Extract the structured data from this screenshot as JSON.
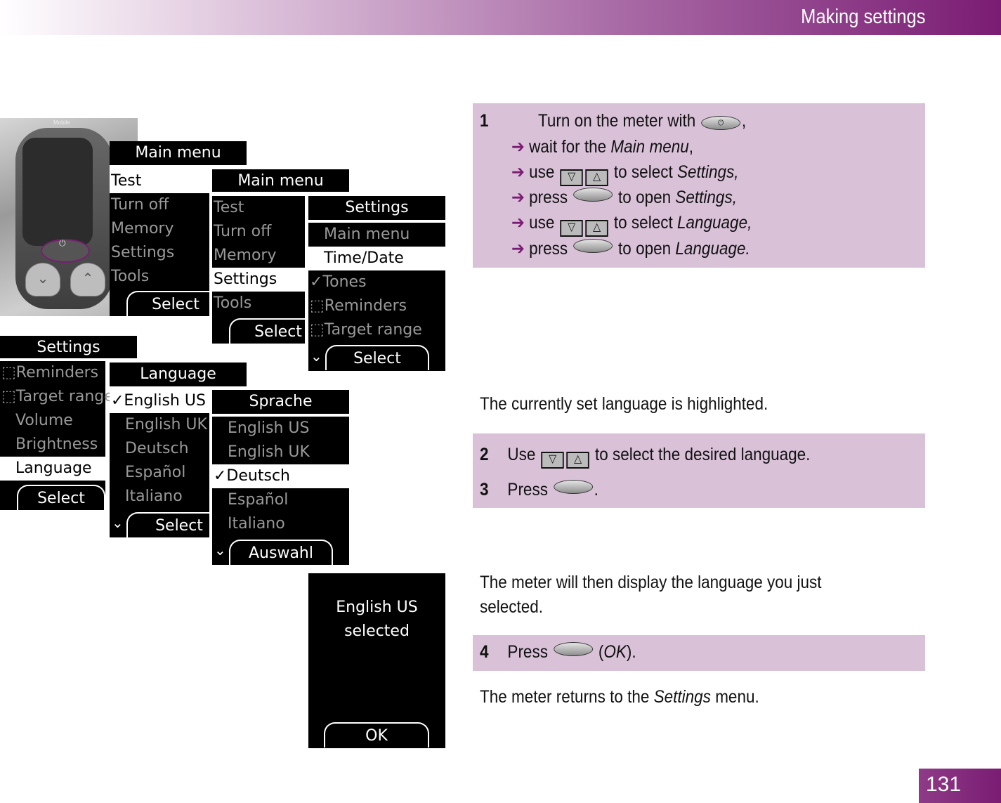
{
  "header": {
    "title": "Making settings"
  },
  "device": {
    "brand": "Mobile"
  },
  "screens": {
    "main1": {
      "title": "Main menu",
      "items": [
        "Test",
        "Turn off",
        "Memory",
        "Settings",
        "Tools"
      ],
      "button": "Select"
    },
    "main2": {
      "title": "Main menu",
      "items": [
        "Test",
        "Turn off",
        "Memory",
        "Settings",
        "Tools"
      ],
      "button": "Select"
    },
    "settings1": {
      "title": "Settings",
      "items": [
        "Main menu",
        "Time/Date",
        "✓Tones",
        "⬚Reminders",
        "⬚Target range"
      ],
      "button": "Select"
    },
    "settings2": {
      "title": "Settings",
      "items": [
        "⬚Reminders",
        "⬚Target range",
        "Volume",
        "Brightness",
        "Language"
      ],
      "button": "Select"
    },
    "language": {
      "title": "Language",
      "items": [
        "✓English US",
        "English UK",
        "Deutsch",
        "Español",
        "Italiano"
      ],
      "button": "Select"
    },
    "sprache": {
      "title": "Sprache",
      "items": [
        "English US",
        "English UK",
        "✓Deutsch",
        "Español",
        "Italiano"
      ],
      "button": "Auswahl"
    },
    "confirm": {
      "line1": "English US",
      "line2": "selected",
      "button": "OK"
    }
  },
  "steps": {
    "s1": {
      "number": "1",
      "line1_pre": "Turn on the meter with",
      "line1_post": ",",
      "line2_pre": "wait for the",
      "line2_em": "Main menu",
      "line2_post": ",",
      "line3_pre": "use",
      "line3_mid": "to select",
      "line3_em": "Settings,",
      "line4_pre": "press",
      "line4_mid": "to open",
      "line4_em": "Settings,",
      "line5_pre": "use",
      "line5_mid": "to select",
      "line5_em": "Language,",
      "line6_pre": "press",
      "line6_mid": "to open",
      "line6_em": "Language."
    },
    "note1": "The currently set language is highlighted.",
    "s2": {
      "number": "2",
      "pre": "Use",
      "post": "to select the desired language."
    },
    "s3": {
      "number": "3",
      "pre": "Press",
      "post": "."
    },
    "note2_line1": "The meter will then display the language you just",
    "note2_line2": "selected.",
    "s4": {
      "number": "4",
      "pre": "Press",
      "post_open": "(",
      "em": "OK",
      "post_close": ")."
    },
    "note3_pre": "The meter returns to the",
    "note3_em": "Settings",
    "note3_post": "menu."
  },
  "icons": {
    "arrow": "➔",
    "down": "▽",
    "up": "△",
    "power": "⏻"
  },
  "colors": {
    "accent": "#7a1c73",
    "panel": "#d9c1d8"
  },
  "page": {
    "number": "131"
  }
}
